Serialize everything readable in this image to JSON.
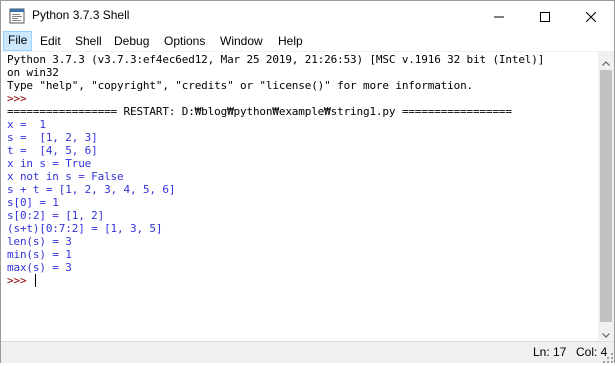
{
  "window": {
    "title": "Python 3.7.3 Shell"
  },
  "menu": {
    "items": [
      {
        "label": "File"
      },
      {
        "label": "Edit"
      },
      {
        "label": "Shell"
      },
      {
        "label": "Debug"
      },
      {
        "label": "Options"
      },
      {
        "label": "Window"
      },
      {
        "label": "Help"
      }
    ]
  },
  "shell": {
    "lines": [
      {
        "text": "Python 3.7.3 (v3.7.3:ef4ec6ed12, Mar 25 2019, 21:26:53) [MSC v.1916 32 bit (Intel)]",
        "color": "#000000"
      },
      {
        "text": "on win32",
        "color": "#000000"
      },
      {
        "text": "Type \"help\", \"copyright\", \"credits\" or \"license()\" for more information.",
        "color": "#000000"
      },
      {
        "text": ">>> ",
        "color": "#8b0000"
      },
      {
        "text": "================= RESTART: D:₩blog₩python₩example₩string1.py =================",
        "color": "#000000"
      },
      {
        "text": "x =  1",
        "color": "#3333dd"
      },
      {
        "text": "s =  [1, 2, 3]",
        "color": "#3333dd"
      },
      {
        "text": "t =  [4, 5, 6]",
        "color": "#3333dd"
      },
      {
        "text": "x in s = True",
        "color": "#3333dd"
      },
      {
        "text": "x not in s = False",
        "color": "#3333dd"
      },
      {
        "text": "s + t = [1, 2, 3, 4, 5, 6]",
        "color": "#3333dd"
      },
      {
        "text": "s[0] = 1",
        "color": "#3333dd"
      },
      {
        "text": "s[0:2] = [1, 2]",
        "color": "#3333dd"
      },
      {
        "text": "(s+t)[0:7:2] = [1, 3, 5]",
        "color": "#3333dd"
      },
      {
        "text": "len(s) = 3",
        "color": "#3333dd"
      },
      {
        "text": "min(s) = 1",
        "color": "#3333dd"
      },
      {
        "text": "max(s) = 3",
        "color": "#3333dd"
      },
      {
        "text": ">>> ",
        "color": "#8b0000"
      }
    ]
  },
  "status": {
    "line": "Ln: 17",
    "col": "Col: 4"
  },
  "icons": {
    "app": "python-shell-icon",
    "minimize": "minimize-icon",
    "maximize": "maximize-icon",
    "close": "close-icon",
    "scroll_up": "chevron-up-icon",
    "scroll_down": "chevron-down-icon"
  }
}
